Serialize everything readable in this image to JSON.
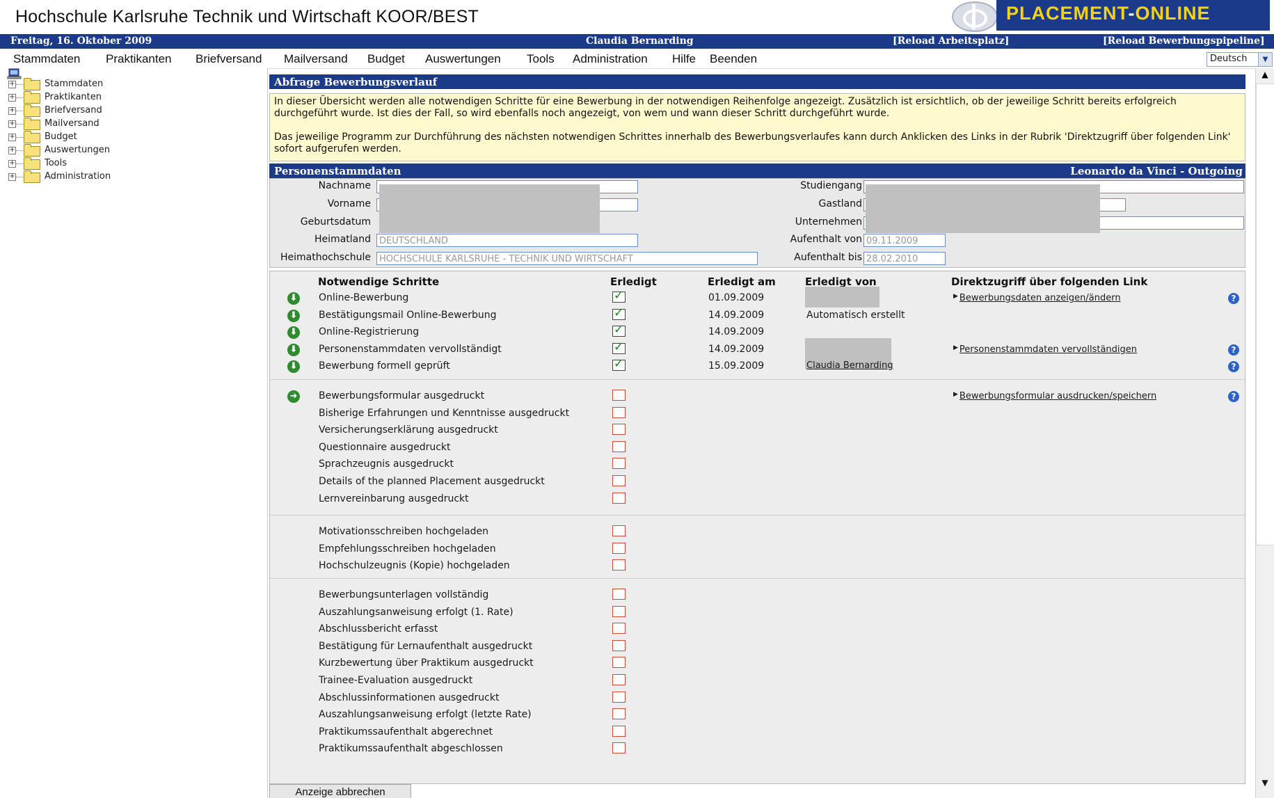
{
  "header": {
    "title": "Hochschule Karlsruhe Technik und Wirtschaft KOOR/BEST",
    "brand_part1": "PLACEMENT",
    "brand_dash": "-",
    "brand_part2": "ONLINE"
  },
  "status_bar": {
    "date": "Freitag, 16. Oktober 2009",
    "user": "Claudia Bernarding",
    "reload_workspace": "[Reload Arbeitsplatz]",
    "reload_pipeline": "[Reload Bewerbungspipeline]"
  },
  "menu": [
    "Stammdaten",
    "Praktikanten",
    "Briefversand",
    "Mailversand",
    "Budget",
    "Auswertungen",
    "Tools",
    "Administration",
    "Hilfe",
    "Beenden"
  ],
  "language": {
    "selected": "Deutsch"
  },
  "sidebar": {
    "items": [
      "Stammdaten",
      "Praktikanten",
      "Briefversand",
      "Mailversand",
      "Budget",
      "Auswertungen",
      "Tools",
      "Administration"
    ]
  },
  "query": {
    "heading": "Abfrage Bewerbungsverlauf",
    "info_para1": "In dieser Übersicht werden alle notwendigen Schritte für eine Bewerbung in der notwendigen Reihenfolge angezeigt. Zusätzlich ist ersichtlich, ob der jeweilige Schritt bereits erfolgreich durchgeführt wurde. Ist dies der Fall, so wird ebenfalls noch angezeigt, von wem und wann dieser Schritt durchgeführt wurde.",
    "info_para2": "Das jeweilige Programm zur Durchführung des nächsten notwendigen Schrittes innerhalb des Bewerbungsverlaufes kann durch Anklicken des Links in der Rubrik 'Direktzugriff über folgenden Link' sofort aufgerufen werden."
  },
  "person": {
    "heading": "Personenstammdaten",
    "program": "Leonardo da Vinci - Outgoing",
    "labels": {
      "nachname": "Nachname",
      "vorname": "Vorname",
      "geburtsdatum": "Geburtsdatum",
      "heimatland": "Heimatland",
      "heimathochschule": "Heimathochschule",
      "studiengang": "Studiengang",
      "gastland": "Gastland",
      "unternehmen": "Unternehmen",
      "aufenthalt_von": "Aufenthalt von",
      "aufenthalt_bis": "Aufenthalt bis"
    },
    "values": {
      "heimatland": "DEUTSCHLAND",
      "heimathochschule": "HOCHSCHULE KARLSRUHE - TECHNIK UND WIRTSCHAFT",
      "aufenthalt_von": "09.11.2009",
      "aufenthalt_bis": "28.02.2010"
    }
  },
  "steps": {
    "columns": {
      "schritte": "Notwendige Schritte",
      "erledigt": "Erledigt",
      "erledigt_am": "Erledigt am",
      "erledigt_von": "Erledigt von",
      "direktzugriff": "Direktzugriff über folgenden Link"
    },
    "groups": [
      [
        {
          "label": "Online-Bewerbung",
          "icon": "done-arrow-icon",
          "done": true,
          "date": "01.09.2009",
          "by": "",
          "by_redacted": true,
          "link": "Bewerbungsdaten anzeigen/ändern",
          "help": true
        },
        {
          "label": "Bestätigungsmail Online-Bewerbung",
          "icon": "done-arrow-icon",
          "done": true,
          "date": "14.09.2009",
          "by": "Automatisch erstellt",
          "link": "",
          "help": false
        },
        {
          "label": "Online-Registrierung",
          "icon": "done-arrow-icon",
          "done": true,
          "date": "14.09.2009",
          "by": "",
          "link": "",
          "help": false
        },
        {
          "label": "Personenstammdaten vervollständigt",
          "icon": "done-arrow-icon",
          "done": true,
          "date": "14.09.2009",
          "by": "",
          "by_redacted": true,
          "link": "Personenstammdaten vervollständigen",
          "help": true
        },
        {
          "label": "Bewerbung formell geprüft",
          "icon": "done-arrow-icon",
          "done": true,
          "date": "15.09.2009",
          "by": "Claudia Bernarding",
          "by_link": true,
          "link": "",
          "help": true
        }
      ],
      [
        {
          "label": "Bewerbungsformular ausgedruckt",
          "icon": "next-arrow-icon",
          "done": false,
          "link": "Bewerbungsformular ausdrucken/speichern",
          "help": true
        },
        {
          "label": "Bisherige Erfahrungen und Kenntnisse ausgedruckt",
          "done": false
        },
        {
          "label": "Versicherungserklärung ausgedruckt",
          "done": false
        },
        {
          "label": "Questionnaire ausgedruckt",
          "done": false
        },
        {
          "label": "Sprachzeugnis ausgedruckt",
          "done": false
        },
        {
          "label": "Details of the planned Placement ausgedruckt",
          "done": false
        },
        {
          "label": "Lernvereinbarung ausgedruckt",
          "done": false
        }
      ],
      [
        {
          "label": "Motivationsschreiben hochgeladen",
          "done": false
        },
        {
          "label": "Empfehlungsschreiben hochgeladen",
          "done": false
        },
        {
          "label": "Hochschulzeugnis (Kopie) hochgeladen",
          "done": false
        }
      ],
      [
        {
          "label": "Bewerbungsunterlagen vollständig",
          "done": false
        },
        {
          "label": "Auszahlungsanweisung erfolgt (1. Rate)",
          "done": false
        },
        {
          "label": "Abschlussbericht erfasst",
          "done": false
        },
        {
          "label": "Bestätigung für Lernaufenthalt ausgedruckt",
          "done": false
        },
        {
          "label": "Kurzbewertung über Praktikum ausgedruckt",
          "done": false
        },
        {
          "label": "Trainee-Evaluation ausgedruckt",
          "done": false
        },
        {
          "label": "Abschlussinformationen ausgedruckt",
          "done": false
        },
        {
          "label": "Auszahlungsanweisung erfolgt (letzte Rate)",
          "done": false
        },
        {
          "label": "Praktikumssaufenthalt abgerechnet",
          "done": false
        },
        {
          "label": "Praktikumssaufenthalt abgeschlossen",
          "done": false
        }
      ]
    ]
  },
  "buttons": {
    "cancel": "Anzeige abbrechen"
  }
}
